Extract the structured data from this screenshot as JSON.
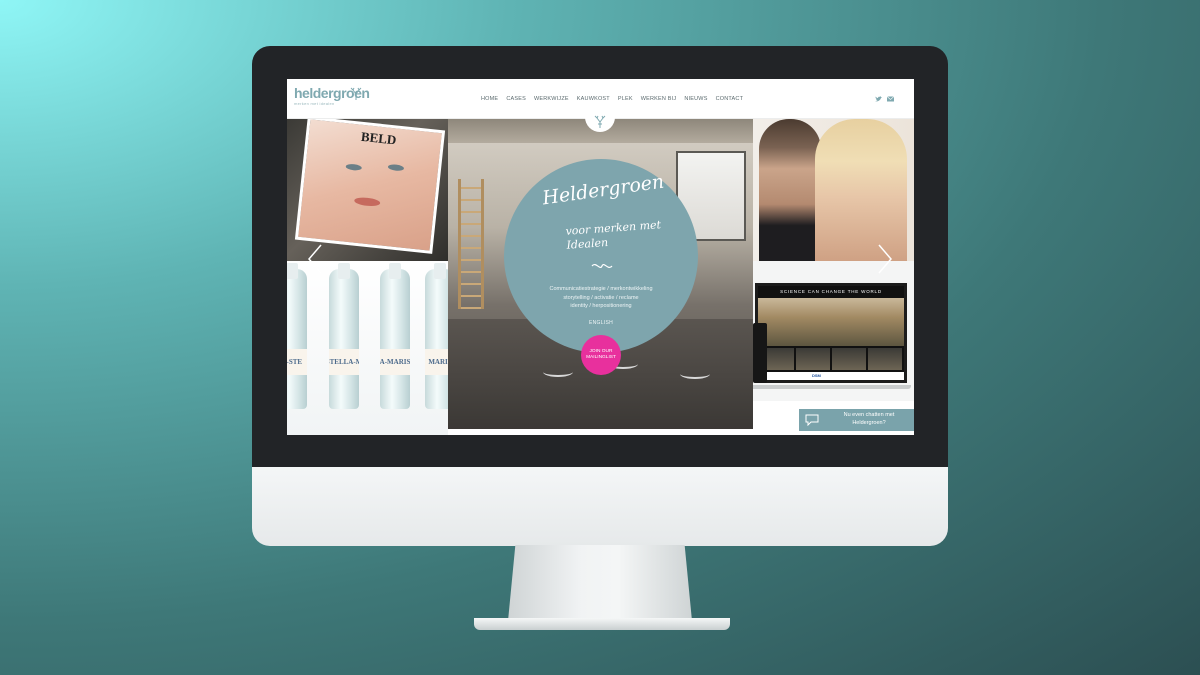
{
  "site": {
    "logo_text": "heldergroen",
    "logo_tagline": "merken met idealen",
    "nav": [
      "HOME",
      "CASES",
      "WERKWIJZE",
      "KAUWKOST",
      "PLEK",
      "WERKEN BIJ",
      "NIEUWS",
      "CONTACT"
    ],
    "social": [
      "twitter-icon",
      "mail-icon"
    ]
  },
  "hero": {
    "title": "Heldergroen",
    "subtitle": "voor merken met Idealen",
    "services": [
      "Communicatiestrategie / merkontwikkeling",
      "storytelling / activatie / reclame",
      "identity / herpositionering"
    ],
    "language_link": "ENGLISH",
    "join_button": "JOIN OUR MAILINGLIST"
  },
  "tiles": {
    "magazine_title": "BELD",
    "bottle_labels": [
      "E-STE",
      "STELLA-M",
      "A-MARIS",
      "MARIS"
    ],
    "laptop_headline": "SCIENCE CAN CHANGE THE WORLD",
    "laptop_brand": "DSM"
  },
  "chat": {
    "text": "Nu even chatten met Heldergroen?"
  },
  "colors": {
    "accent": "#7ea5ad",
    "pink": "#e8309d",
    "background_top": "#8ff6f6",
    "background_bottom": "#2c4f52"
  }
}
